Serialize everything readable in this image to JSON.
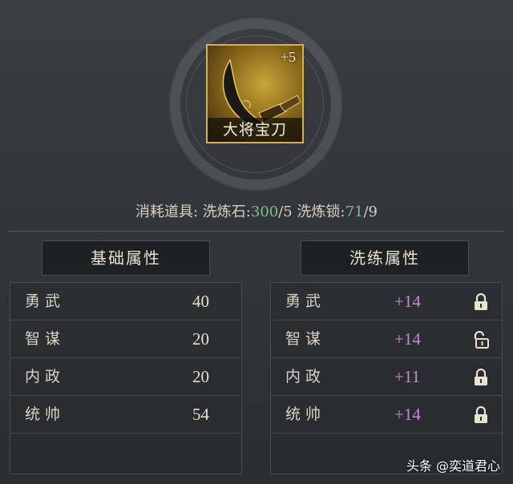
{
  "item": {
    "name": "大将宝刀",
    "level": "+5",
    "icon": "broadsword-icon"
  },
  "consume": {
    "label": "消耗道具:",
    "stone_label": "洗炼石:",
    "stone_have": "300",
    "stone_need": "/5",
    "lock_label": "洗炼锁:",
    "lock_have": "71",
    "lock_need": "/9"
  },
  "base": {
    "title": "基础属性",
    "rows": [
      {
        "name": "勇武",
        "value": "40"
      },
      {
        "name": "智谋",
        "value": "20"
      },
      {
        "name": "内政",
        "value": "20"
      },
      {
        "name": "统帅",
        "value": "54"
      }
    ]
  },
  "refine": {
    "title": "洗练属性",
    "rows": [
      {
        "name": "勇武",
        "value": "+14",
        "locked": true
      },
      {
        "name": "智谋",
        "value": "+14",
        "locked": false
      },
      {
        "name": "内政",
        "value": "+11",
        "locked": true
      },
      {
        "name": "统帅",
        "value": "+14",
        "locked": true
      }
    ]
  },
  "watermark": "头条 @奕道君心",
  "colors": {
    "accent_gold": "#d8b248",
    "bonus_purple": "#c58bd8",
    "stock_green": "#7ec08a"
  }
}
